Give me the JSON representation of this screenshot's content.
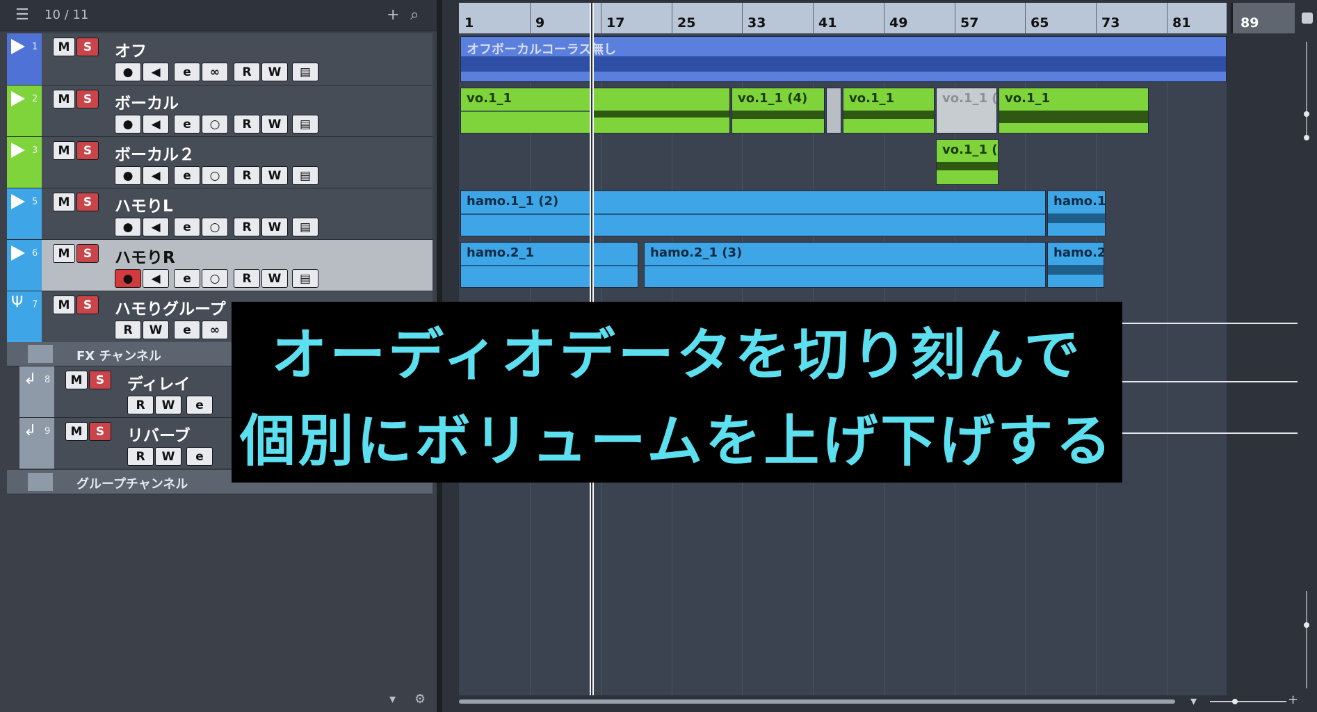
{
  "toolbar": {
    "track_count": "10 / 11",
    "add_icon": "plus-icon",
    "search_icon": "search-icon",
    "list_icon": "list-icon"
  },
  "tracks": [
    {
      "num": "1",
      "name": "オフ",
      "color": "#4f72d6",
      "m": "M",
      "s": "S"
    },
    {
      "num": "2",
      "name": "ボーカル",
      "color": "#7fd43b",
      "m": "M",
      "s": "S"
    },
    {
      "num": "3",
      "name": "ボーカル２",
      "color": "#7fd43b",
      "m": "M",
      "s": "S"
    },
    {
      "num": "5",
      "name": "ハモりL",
      "color": "#3ea6e6",
      "m": "M",
      "s": "S"
    },
    {
      "num": "6",
      "name": "ハモりR",
      "color": "#3ea6e6",
      "m": "M",
      "s": "S"
    },
    {
      "num": "7",
      "name": "ハモりグループ",
      "color": "#3ea6e6",
      "m": "M",
      "s": "S"
    },
    {
      "num": "8",
      "name": "ディレイ",
      "m": "M",
      "s": "S"
    },
    {
      "num": "9",
      "name": "リバーブ",
      "m": "M",
      "s": "S"
    }
  ],
  "channel_buttons": {
    "read": "R",
    "write": "W",
    "edit": "e"
  },
  "folders": {
    "fx": "FX チャンネル",
    "group": "グループチャンネル"
  },
  "ruler": {
    "bars": [
      "1",
      "9",
      "17",
      "25",
      "33",
      "41",
      "49",
      "57",
      "65",
      "73",
      "81",
      "89"
    ]
  },
  "parts": {
    "off": "オフボーカルコーラス無し",
    "vo1": "vo.1_1",
    "vo1_4": "vo.1_1 (4)",
    "vo1_b": "vo.1_1",
    "vo1_c": "vo.1_1 (",
    "vo1_d": "vo.1_1",
    "vo2_c": "vo.1_1 (",
    "hamo1": "hamo.1_1 (2)",
    "hamo1_b": "hamo.1",
    "hamo2": "hamo.2_1",
    "hamo2_3": "hamo.2_1 (3)",
    "hamo2_b": "hamo.2"
  },
  "caption": {
    "line1": "オーディオデータを切り刻んで",
    "line2": "個別にボリュームを上げ下げする",
    "color": "#5ce0f0"
  }
}
